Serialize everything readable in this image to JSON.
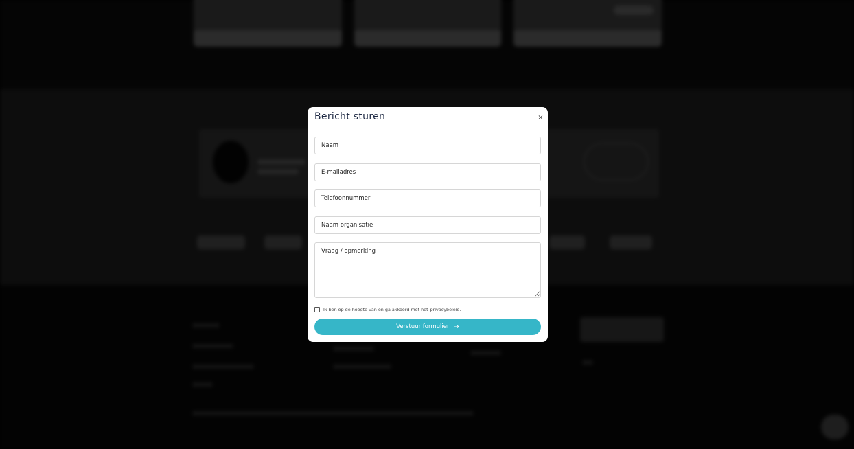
{
  "modal": {
    "title": "Bericht sturen",
    "close_icon": "×",
    "fields": {
      "name_placeholder": "Naam",
      "email_placeholder": "E-mailadres",
      "phone_placeholder": "Telefoonnummer",
      "organisation_placeholder": "Naam organisatie",
      "message_placeholder": "Vraag / opmerking"
    },
    "consent": {
      "text": "Ik ben op de hoogte van en ga akkoord met het",
      "link": "privacybeleid",
      "suffix": "."
    },
    "submit": {
      "label": "Verstuur formulier",
      "icon": "→"
    },
    "colors": {
      "accent": "#36b6c8",
      "title": "#1f2a44"
    }
  }
}
